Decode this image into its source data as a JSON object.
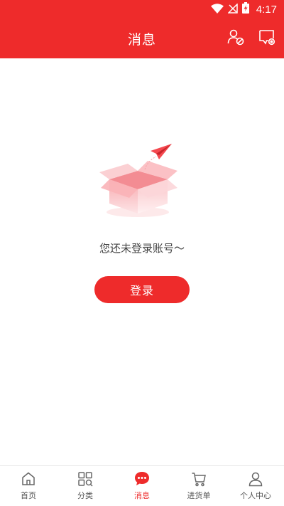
{
  "status_bar": {
    "time": "4:17",
    "icons": [
      "wifi-icon",
      "no-signal-icon",
      "battery-charging-icon"
    ]
  },
  "header": {
    "title": "消息",
    "right_icons": [
      "user-settings-icon",
      "message-settings-icon"
    ]
  },
  "empty_state": {
    "illustration": "open-box-with-paper-plane",
    "message": "您还未登录账号～",
    "login_label": "登录"
  },
  "tabbar": {
    "items": [
      {
        "label": "首页",
        "icon": "home-icon"
      },
      {
        "label": "分类",
        "icon": "category-grid-icon"
      },
      {
        "label": "消息",
        "icon": "chat-bubble-icon",
        "active": true
      },
      {
        "label": "进货单",
        "icon": "cart-icon"
      },
      {
        "label": "个人中心",
        "icon": "person-icon"
      }
    ]
  },
  "colors": {
    "brand": "#ee2b2b",
    "text": "#444444",
    "tab_text": "#555555"
  }
}
